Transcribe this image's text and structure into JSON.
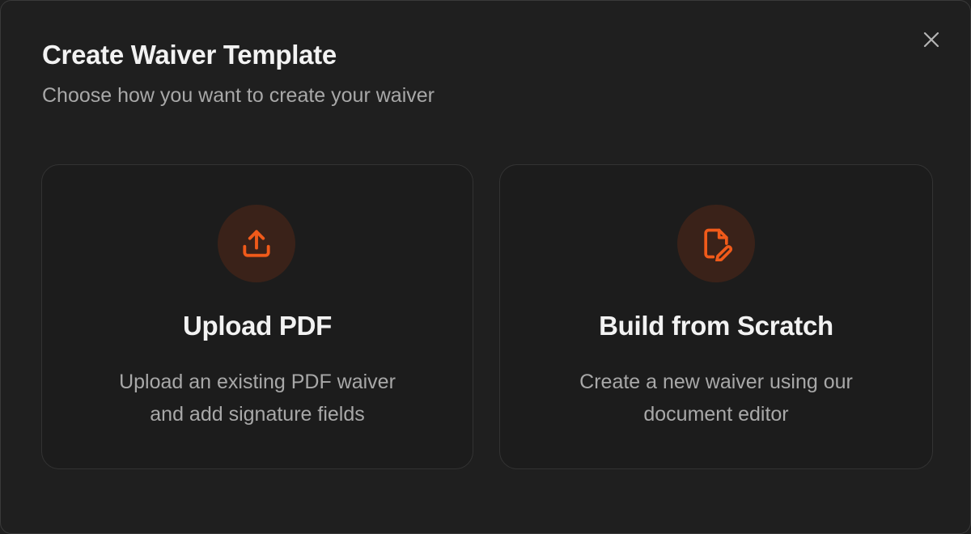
{
  "dialog": {
    "title": "Create Waiver Template",
    "subtitle": "Choose how you want to create your waiver",
    "close_icon": "close-icon"
  },
  "options": [
    {
      "id": "upload-pdf",
      "icon": "upload-icon",
      "title": "Upload PDF",
      "description_line1": "Upload an existing PDF waiver",
      "description_line2": "and add signature fields"
    },
    {
      "id": "build-from-scratch",
      "icon": "file-edit-icon",
      "title": "Build from Scratch",
      "description_line1": "Create a new waiver using our",
      "description_line2": "document editor"
    }
  ],
  "colors": {
    "background": "#1f1f1f",
    "accent": "#f05a1a",
    "icon_circle": "#3a2219",
    "text_primary": "#f2f2f2",
    "text_secondary": "#a8a8a8"
  }
}
